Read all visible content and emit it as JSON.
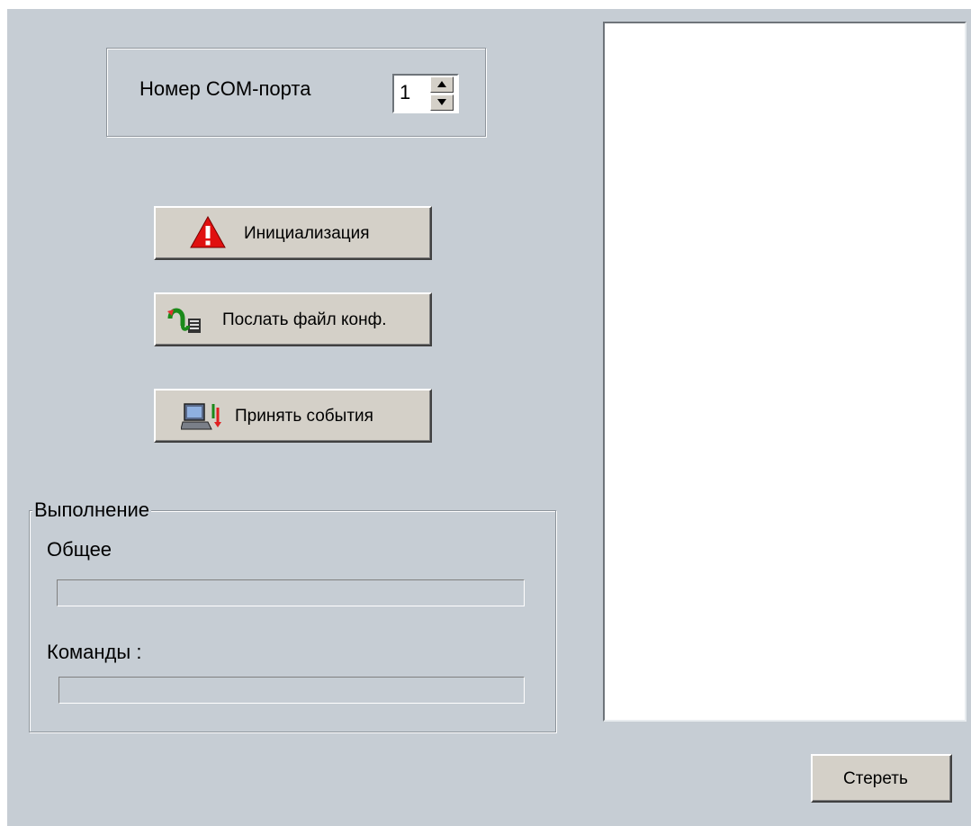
{
  "com_port": {
    "label": "Номер COM-порта",
    "value": "1"
  },
  "buttons": {
    "init": "Инициализация",
    "send_config": "Послать файл конф.",
    "receive_events": "Принять события",
    "clear": "Стереть"
  },
  "progress": {
    "title": "Выполнение",
    "overall_label": "Общее",
    "overall_value": 0,
    "commands_label": "Команды :",
    "commands_value": 0
  },
  "icons": {
    "init": "warning-triangle-icon",
    "send_config": "send-file-icon",
    "receive_events": "receive-events-icon"
  },
  "colors": {
    "background": "#c6cdd4",
    "warning_red": "#e01010"
  }
}
